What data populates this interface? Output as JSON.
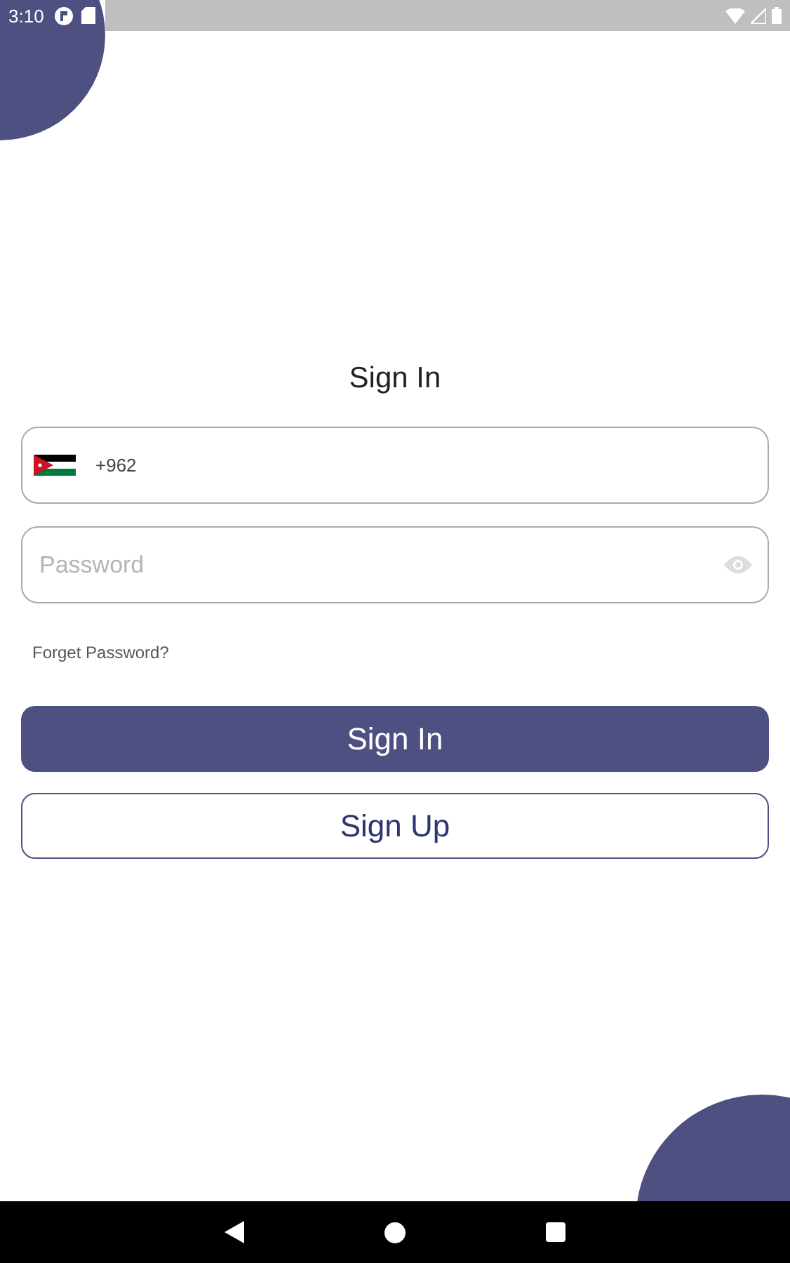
{
  "status_bar": {
    "time": "3:10"
  },
  "title": "Sign In",
  "phone_field": {
    "country_code": "+962"
  },
  "password_field": {
    "placeholder": "Password"
  },
  "forgot_link": "Forget Password?",
  "buttons": [
    {
      "label": "Sign In",
      "kind": "primary"
    },
    {
      "label": "Sign Up",
      "kind": "outline"
    }
  ]
}
